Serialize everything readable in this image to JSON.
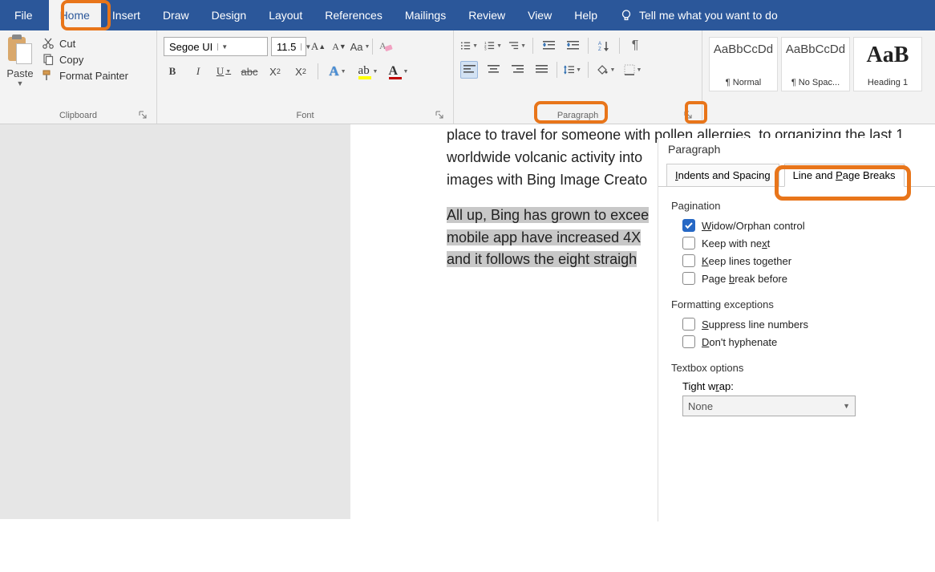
{
  "tabs": {
    "file": "File",
    "home": "Home",
    "insert": "Insert",
    "draw": "Draw",
    "design": "Design",
    "layout": "Layout",
    "references": "References",
    "mailings": "Mailings",
    "review": "Review",
    "view": "View",
    "help": "Help",
    "tellme": "Tell me what you want to do"
  },
  "ribbon": {
    "clipboard": {
      "paste": "Paste",
      "cut": "Cut",
      "copy": "Copy",
      "format_painter": "Format Painter",
      "label": "Clipboard"
    },
    "font": {
      "name": "Segoe UI",
      "size": "11.5",
      "label": "Font"
    },
    "paragraph": {
      "label": "Paragraph"
    },
    "styles": {
      "sample": "AaBbCcDd",
      "sample_h1": "AaB",
      "normal": "¶ Normal",
      "nospacing": "¶ No Spac...",
      "heading1": "Heading 1"
    }
  },
  "doc": {
    "line1": "place to travel for someone with pollen allergies, to organizing the last 1",
    "line2": "worldwide volcanic activity into",
    "line3": "images with Bing Image Creato",
    "sel1": "All up, Bing has grown to excee",
    "sel2": "mobile app have increased 4X ",
    "sel3": "and it follows the eight straigh"
  },
  "dialog": {
    "title": "Paragraph",
    "tab_indents": "Indents and Spacing",
    "tab_linepage_pre": "Line and ",
    "tab_linepage_u": "P",
    "tab_linepage_post": "age Breaks",
    "section_pagination": "Pagination",
    "widow_pre": "",
    "widow_u": "W",
    "widow_post": "idow/Orphan control",
    "keepnext": "Keep with ne",
    "keepnext_u": "x",
    "keepnext_post": "t",
    "keeplines_u": "K",
    "keeplines_post": "eep lines together",
    "pagebreak_pre": "Page ",
    "pagebreak_u": "b",
    "pagebreak_post": "reak before",
    "section_format": "Formatting exceptions",
    "suppress_u": "S",
    "suppress_post": "uppress line numbers",
    "dont_u": "D",
    "dont_post": "on't hyphenate",
    "section_textbox": "Textbox options",
    "tightwrap_pre": "Tight w",
    "tightwrap_u": "r",
    "tightwrap_post": "ap:",
    "tightwrap_value": "None"
  }
}
